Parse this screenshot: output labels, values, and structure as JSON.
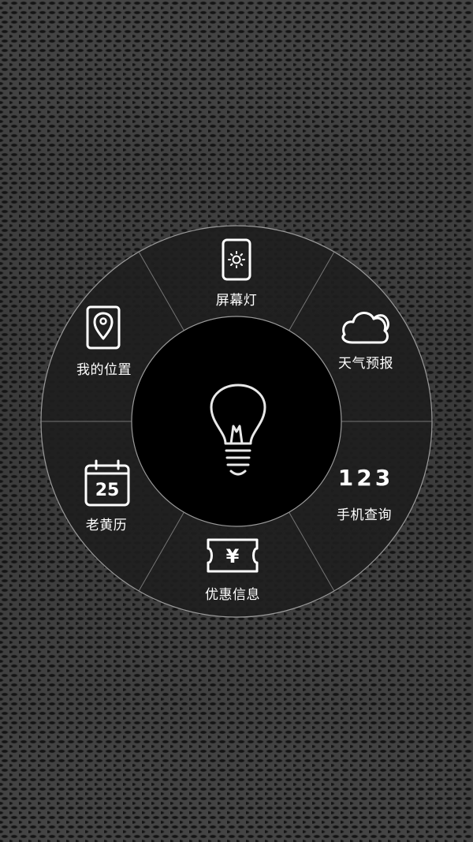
{
  "menu": {
    "center_button_icon": "lightbulb-icon",
    "items": [
      {
        "id": "screen-light",
        "label": "屏幕灯",
        "icon": "screen-light-icon"
      },
      {
        "id": "weather",
        "label": "天气预报",
        "icon": "cloud-icon"
      },
      {
        "id": "phone-lookup",
        "label": "手机查询",
        "icon": "numbers-icon",
        "icon_text": "123"
      },
      {
        "id": "coupons",
        "label": "优惠信息",
        "icon": "coupon-ticket-icon",
        "icon_text": "¥"
      },
      {
        "id": "almanac",
        "label": "老黄历",
        "icon": "calendar-icon",
        "icon_text": "25"
      },
      {
        "id": "my-location",
        "label": "我的位置",
        "icon": "location-pin-icon"
      }
    ]
  },
  "colors": {
    "ring": "#1e1e1e",
    "ring_edge": "#9a9a9a",
    "center": "#000000",
    "icon": "#ffffff",
    "divider": "#8a8a8a"
  }
}
